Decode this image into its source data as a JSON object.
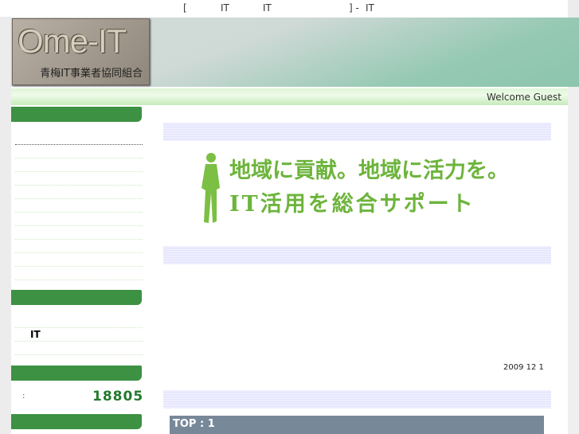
{
  "title_bar": {
    "bracket_open": "[",
    "it1": "IT",
    "it2": "IT",
    "bracket_close": "] -",
    "it3": "IT"
  },
  "header": {
    "logo_text": "Ome-IT",
    "logo_subtitle": "青梅IT事業者協同組合"
  },
  "user": {
    "welcome": "Welcome Guest"
  },
  "sidebar": {
    "link_it": "IT",
    "counter_label": ":",
    "counter_value": "18805"
  },
  "banner": {
    "line1": "地域に貢献。地域に活力を。",
    "line2": "IT活用を総合サポート"
  },
  "main": {
    "date": "2009 12 1",
    "top_bar": "TOP : 1"
  },
  "colors": {
    "sidebar_green": "#3d9142",
    "counter_green": "#237a2e",
    "topbar": "#778899"
  }
}
